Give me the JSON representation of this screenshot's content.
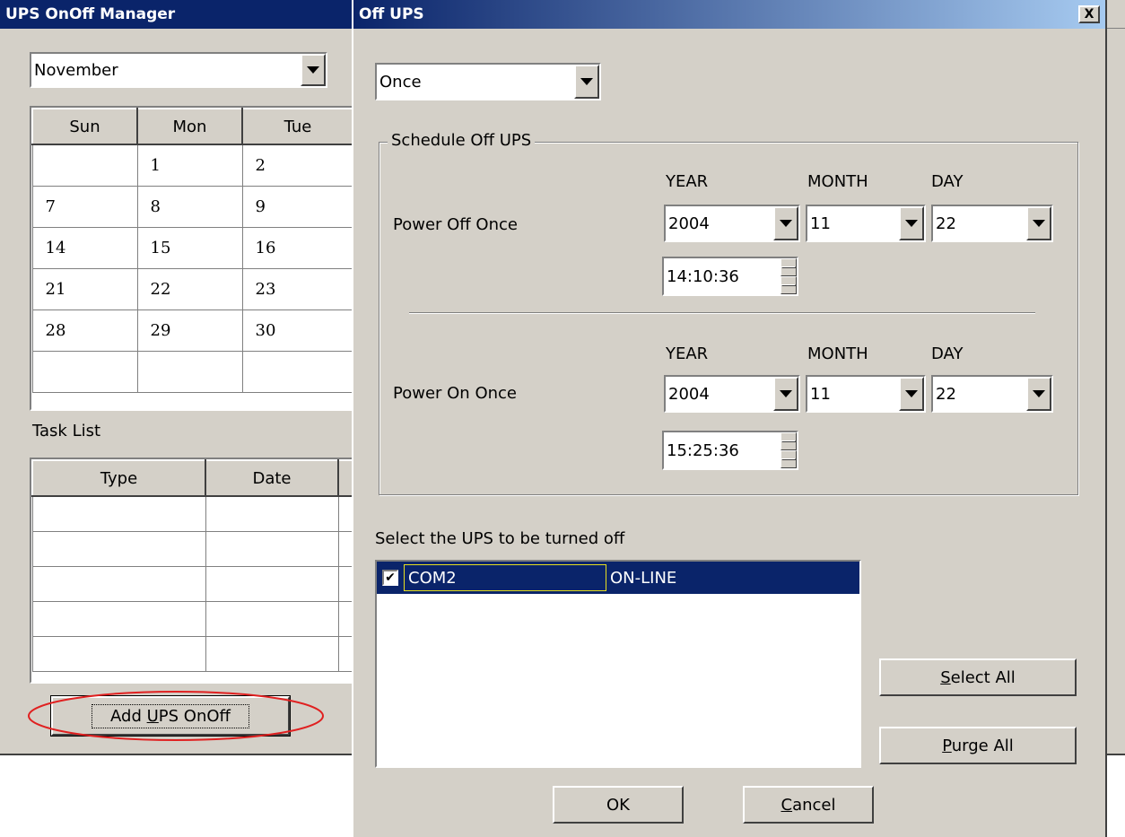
{
  "manager": {
    "title": "UPS OnOff Manager",
    "month": "November",
    "calendar_headers": [
      "Sun",
      "Mon",
      "Tue"
    ],
    "calendar_rows": [
      [
        "",
        "1",
        "2"
      ],
      [
        "7",
        "8",
        "9"
      ],
      [
        "14",
        "15",
        "16"
      ],
      [
        "21",
        "22",
        "23"
      ],
      [
        "28",
        "29",
        "30"
      ],
      [
        "",
        "",
        ""
      ]
    ],
    "task_list_label": "Task List",
    "task_headers": [
      "Type",
      "Date"
    ],
    "add_button_pre": "Add ",
    "add_button_u": "U",
    "add_button_post": "PS OnOff"
  },
  "dialog": {
    "title": "Off UPS",
    "close_label": "X",
    "frequency": "Once",
    "schedule_group_label": "Schedule Off UPS",
    "off": {
      "label": "Power Off Once",
      "year_header": "YEAR",
      "month_header": "MONTH",
      "day_header": "DAY",
      "year": "2004",
      "month": "11",
      "day": "22",
      "time": "14:10:36"
    },
    "on": {
      "label": "Power On Once",
      "year_header": "YEAR",
      "month_header": "MONTH",
      "day_header": "DAY",
      "year": "2004",
      "month": "11",
      "day": "22",
      "time": "15:25:36"
    },
    "select_label": "Select the UPS to be turned off",
    "ups_list": [
      {
        "port": "COM2",
        "status": "ON-LINE",
        "checked": true
      }
    ],
    "select_all_u": "S",
    "select_all_rest": "elect All",
    "purge_all_u": "P",
    "purge_all_rest": "urge All",
    "ok_label": "OK",
    "cancel_u": "C",
    "cancel_rest": "ancel"
  },
  "colors": {
    "title_bar_start": "#0a246a",
    "title_bar_end": "#a6caf0",
    "selection": "#0a246a",
    "face": "#d4d0c8",
    "highlight_oval": "#e02020"
  }
}
